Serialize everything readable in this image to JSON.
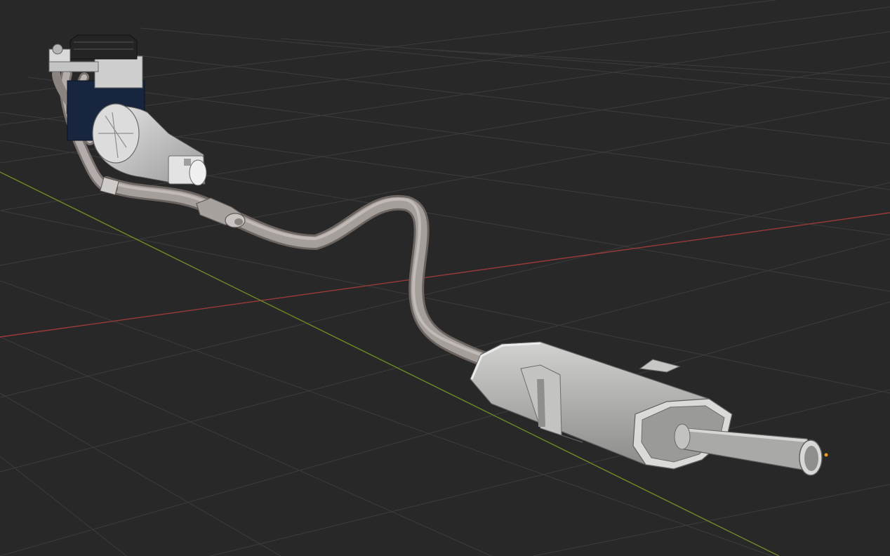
{
  "viewport": {
    "mode": "3d-viewport-solid-shading",
    "grid": true,
    "axis_x_color": "#9a3a3a",
    "axis_y_color": "#6c8a26",
    "background_color": "#282828",
    "grid_color": "#3c3c3c"
  },
  "scene": {
    "objects": [
      {
        "name": "engine-block",
        "icon": "engine-model"
      },
      {
        "name": "gearbox",
        "icon": "gearbox-model"
      },
      {
        "name": "exhaust-manifold",
        "icon": "pipe-model"
      },
      {
        "name": "catalytic-converter",
        "icon": "pipe-joint-model"
      },
      {
        "name": "exhaust-pipe",
        "icon": "pipe-model"
      },
      {
        "name": "rear-muffler",
        "icon": "muffler-model"
      },
      {
        "name": "tailpipe",
        "icon": "pipe-model"
      }
    ],
    "origin_marker_color": "#f29a1a"
  }
}
